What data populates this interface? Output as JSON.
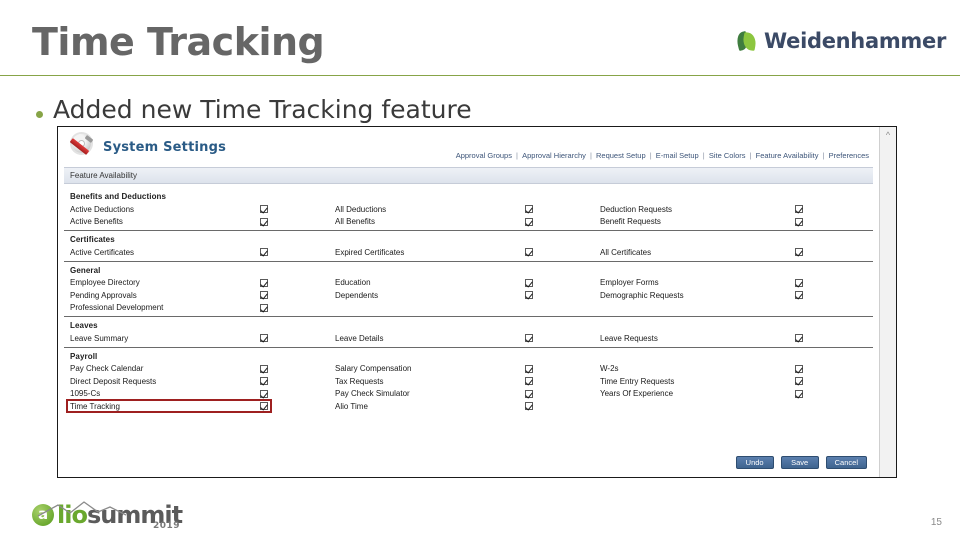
{
  "slide": {
    "title": "Time Tracking",
    "bullet": "Added new Time Tracking feature",
    "page_number": "15",
    "accent_color": "#87a447",
    "title_color": "#666666"
  },
  "brand": {
    "name": "Weidenhammer",
    "icon": "leaf-logo-icon"
  },
  "footer": {
    "logo_a": "a",
    "logo_lio": "lio",
    "logo_summit": "summit",
    "logo_year": "2019"
  },
  "screenshot": {
    "app_title": "System Settings",
    "app_icon": "gear-screwdriver-icon",
    "nav_links": [
      "Approval Groups",
      "Approval Hierarchy",
      "Request Setup",
      "E-mail Setup",
      "Site Colors",
      "Feature Availability",
      "Preferences"
    ],
    "nav_separator": "|",
    "section_bar_label": "Feature Availability",
    "scroll_up_icon": "chevron-up-icon",
    "groups": [
      {
        "title": "Benefits and Deductions",
        "rows": [
          [
            {
              "label": "Active Deductions",
              "checked": true
            },
            {
              "label": "All Deductions",
              "checked": true
            },
            {
              "label": "Deduction Requests",
              "checked": true
            }
          ],
          [
            {
              "label": "Active Benefits",
              "checked": true
            },
            {
              "label": "All Benefits",
              "checked": true
            },
            {
              "label": "Benefit Requests",
              "checked": true
            }
          ]
        ]
      },
      {
        "title": "Certificates",
        "rows": [
          [
            {
              "label": "Active Certificates",
              "checked": true
            },
            {
              "label": "Expired Certificates",
              "checked": true
            },
            {
              "label": "All Certificates",
              "checked": true
            }
          ]
        ]
      },
      {
        "title": "General",
        "rows": [
          [
            {
              "label": "Employee Directory",
              "checked": true
            },
            {
              "label": "Education",
              "checked": true
            },
            {
              "label": "Employer Forms",
              "checked": true
            }
          ],
          [
            {
              "label": "Pending Approvals",
              "checked": true
            },
            {
              "label": "Dependents",
              "checked": true
            },
            {
              "label": "Demographic Requests",
              "checked": true
            }
          ],
          [
            {
              "label": "Professional Development",
              "checked": true
            },
            {
              "label": "",
              "checked": null
            },
            {
              "label": "",
              "checked": null
            }
          ]
        ]
      },
      {
        "title": "Leaves",
        "rows": [
          [
            {
              "label": "Leave Summary",
              "checked": true
            },
            {
              "label": "Leave Details",
              "checked": true
            },
            {
              "label": "Leave Requests",
              "checked": true
            }
          ]
        ]
      },
      {
        "title": "Payroll",
        "rows": [
          [
            {
              "label": "Pay Check Calendar",
              "checked": true
            },
            {
              "label": "Salary Compensation",
              "checked": true
            },
            {
              "label": "W-2s",
              "checked": true
            }
          ],
          [
            {
              "label": "Direct Deposit Requests",
              "checked": true
            },
            {
              "label": "Tax Requests",
              "checked": true
            },
            {
              "label": "Time Entry Requests",
              "checked": true
            }
          ],
          [
            {
              "label": "1095-Cs",
              "checked": true
            },
            {
              "label": "Pay Check Simulator",
              "checked": true
            },
            {
              "label": "Years Of Experience",
              "checked": true
            }
          ],
          [
            {
              "label": "Time Tracking",
              "checked": true,
              "highlight": true
            },
            {
              "label": "Alio Time",
              "checked": true
            },
            {
              "label": "",
              "checked": null
            }
          ]
        ]
      }
    ],
    "buttons": [
      "Undo",
      "Save",
      "Cancel"
    ],
    "highlight_color": "#9e2020"
  }
}
